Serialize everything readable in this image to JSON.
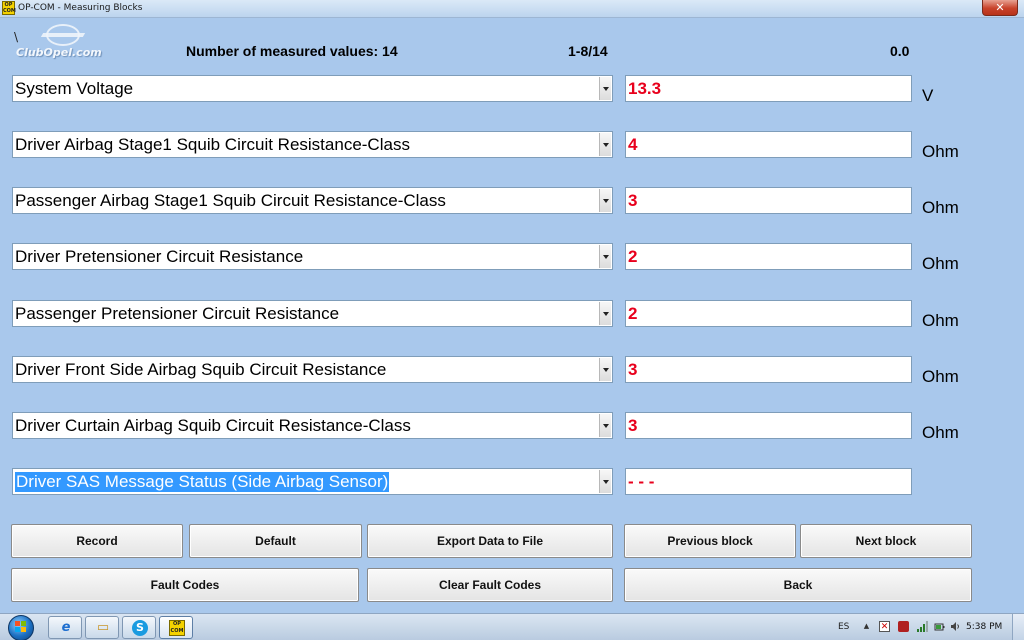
{
  "window": {
    "title": "OP-COM - Measuring Blocks",
    "app_icon_text": "OP COM",
    "close_glyph": "✕"
  },
  "header": {
    "logo_symbol": "\\",
    "logo_text": "ClubOpel.com",
    "measured_count_label": "Number of measured values: 14",
    "page_indicator": "1-8/14",
    "time_value": "0.0"
  },
  "rows": [
    {
      "parameter": "System Voltage",
      "value": "13.3",
      "unit": "V"
    },
    {
      "parameter": "Driver Airbag Stage1 Squib Circuit Resistance-Class",
      "value": "4",
      "unit": "Ohm"
    },
    {
      "parameter": "Passenger Airbag Stage1 Squib Circuit Resistance-Class",
      "value": "3",
      "unit": "Ohm"
    },
    {
      "parameter": "Driver Pretensioner Circuit Resistance",
      "value": "2",
      "unit": "Ohm"
    },
    {
      "parameter": "Passenger Pretensioner Circuit Resistance",
      "value": "2",
      "unit": "Ohm"
    },
    {
      "parameter": "Driver Front Side Airbag Squib Circuit Resistance",
      "value": "3",
      "unit": "Ohm"
    },
    {
      "parameter": "Driver Curtain Airbag Squib Circuit Resistance-Class",
      "value": "3",
      "unit": "Ohm"
    },
    {
      "parameter": "Driver SAS Message Status (Side Airbag Sensor)",
      "value": "- - -",
      "unit": ""
    }
  ],
  "buttons": {
    "record": "Record",
    "default": "Default",
    "export": "Export Data to File",
    "previous": "Previous block",
    "next": "Next block",
    "fault_codes": "Fault Codes",
    "clear_fault_codes": "Clear Fault Codes",
    "back": "Back"
  },
  "taskbar": {
    "ie_glyph": "e",
    "explorer_glyph": "▭",
    "skype_glyph": "S",
    "opcom_text": "OP COM",
    "tray_lang": "ES",
    "tray_up_glyph": "▲",
    "clock": "5:38 PM"
  },
  "colors": {
    "background": "#a9c8ec",
    "value_text": "#e8001c",
    "selection": "#3399ff",
    "close_button": "#c8422b"
  }
}
